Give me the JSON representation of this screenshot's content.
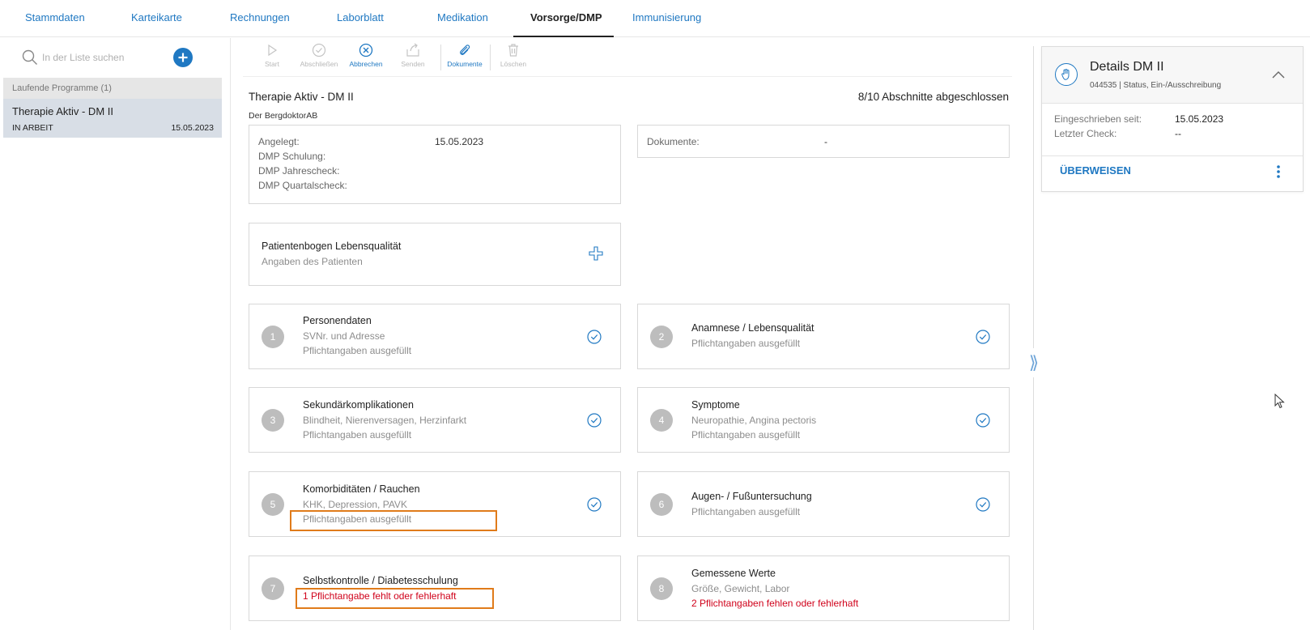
{
  "nav": {
    "tabs": [
      {
        "label": "Stammdaten"
      },
      {
        "label": "Karteikarte"
      },
      {
        "label": "Rechnungen"
      },
      {
        "label": "Laborblatt"
      },
      {
        "label": "Medikation"
      },
      {
        "label": "Vorsorge/DMP",
        "active": true
      },
      {
        "label": "Immunisierung"
      }
    ]
  },
  "sidebar": {
    "search_placeholder": "In der Liste suchen",
    "group_header": "Laufende Programme (1)",
    "program": {
      "title": "Therapie Aktiv - DM II",
      "status": "IN ARBEIT",
      "date": "15.05.2023"
    }
  },
  "toolbar": {
    "items": [
      {
        "label": "Start",
        "icon": "play-icon",
        "enabled": false
      },
      {
        "label": "Abschließen",
        "icon": "check-circle-icon",
        "enabled": false
      },
      {
        "label": "Abbrechen",
        "icon": "cancel-circle-icon",
        "enabled": true
      },
      {
        "label": "Senden",
        "icon": "send-icon",
        "enabled": false
      },
      {
        "label": "Dokumente",
        "icon": "paperclip-icon",
        "enabled": true
      },
      {
        "label": "Löschen",
        "icon": "trash-icon",
        "enabled": false
      }
    ]
  },
  "content": {
    "title": "Therapie Aktiv - DM II",
    "progress": "8/10 Abschnitte abgeschlossen",
    "subtitle": "Der BergdoktorAB",
    "info": {
      "angelegt_label": "Angelegt:",
      "angelegt_value": "15.05.2023",
      "schulung_label": "DMP Schulung:",
      "jahrescheck_label": "DMP Jahrescheck:",
      "quartalscheck_label": "DMP Quartalscheck:"
    },
    "documents": {
      "label": "Dokumente:",
      "value": "-"
    },
    "patientenbogen": {
      "title": "Patientenbogen Lebensqualität",
      "subtitle": "Angaben des Patienten"
    },
    "sections": [
      {
        "num": "1",
        "title": "Personendaten",
        "lines": [
          "SVNr. und Adresse",
          "Pflichtangaben ausgefüllt"
        ],
        "complete": true
      },
      {
        "num": "2",
        "title": "Anamnese / Lebensqualität",
        "lines": [
          "Pflichtangaben ausgefüllt"
        ],
        "complete": true
      },
      {
        "num": "3",
        "title": "Sekundärkomplikationen",
        "lines": [
          "Blindheit, Nierenversagen, Herzinfarkt",
          "Pflichtangaben ausgefüllt"
        ],
        "complete": true
      },
      {
        "num": "4",
        "title": "Symptome",
        "lines": [
          "Neuropathie, Angina pectoris",
          "Pflichtangaben ausgefüllt"
        ],
        "complete": true
      },
      {
        "num": "5",
        "title": "Komorbiditäten / Rauchen",
        "lines": [
          "KHK, Depression, PAVK",
          "Pflichtangaben ausgefüllt"
        ],
        "complete": true
      },
      {
        "num": "6",
        "title": "Augen- / Fußuntersuchung",
        "lines": [
          "Pflichtangaben ausgefüllt"
        ],
        "complete": true
      },
      {
        "num": "7",
        "title": "Selbstkontrolle / Diabetesschulung",
        "lines": [
          "1 Pflichtangabe fehlt oder fehlerhaft"
        ],
        "complete": false
      },
      {
        "num": "8",
        "title": "Gemessene Werte",
        "lines": [
          "Größe, Gewicht, Labor",
          "2 Pflichtangaben fehlen oder fehlerhaft"
        ],
        "complete": false
      }
    ]
  },
  "details": {
    "title": "Details DM II",
    "subtitle": "044535 | Status, Ein-/Ausschreibung",
    "enrolled_label": "Eingeschrieben seit:",
    "enrolled_value": "15.05.2023",
    "lastcheck_label": "Letzter Check:",
    "lastcheck_value": "--",
    "action_label": "ÜBERWEISEN"
  },
  "colors": {
    "accent": "#1f78c2",
    "error": "#d0021b",
    "highlight": "#e07b1a"
  }
}
